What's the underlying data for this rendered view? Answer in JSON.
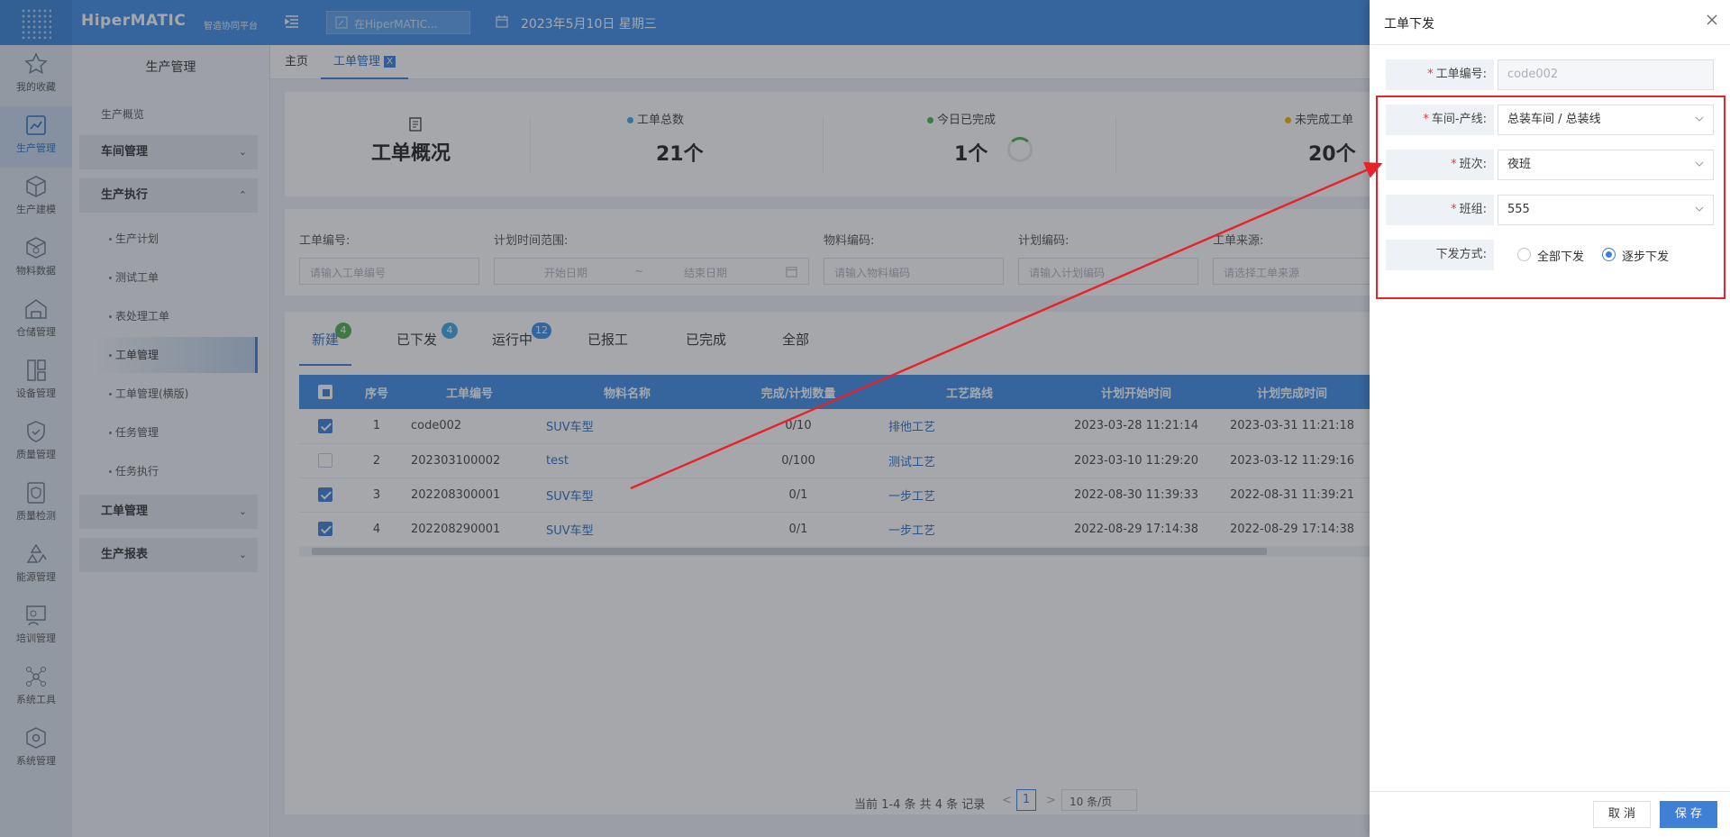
{
  "header": {
    "brand": "HiperMATIC",
    "brand_sub": "智造协同平台",
    "search_placeholder": "在HiperMATIC...",
    "date": "2023年5月10日 星期三"
  },
  "rail": [
    {
      "label": "我的收藏",
      "icon": "star-icon"
    },
    {
      "label": "生产管理",
      "icon": "production-icon"
    },
    {
      "label": "生产建模",
      "icon": "cube-icon"
    },
    {
      "label": "物料数据",
      "icon": "box-icon"
    },
    {
      "label": "仓储管理",
      "icon": "warehouse-icon"
    },
    {
      "label": "设备管理",
      "icon": "device-icon"
    },
    {
      "label": "质量管理",
      "icon": "shield-icon"
    },
    {
      "label": "质量检测",
      "icon": "shield-check-icon"
    },
    {
      "label": "能源管理",
      "icon": "recycle-icon"
    },
    {
      "label": "培训管理",
      "icon": "training-icon"
    },
    {
      "label": "系统工具",
      "icon": "network-icon"
    },
    {
      "label": "系统管理",
      "icon": "settings-cube-icon"
    }
  ],
  "sidebar": {
    "title": "生产管理",
    "overview": "生产概览",
    "groups": {
      "workshop": "车间管理",
      "execution": "生产执行",
      "workorder": "工单管理",
      "report": "生产报表"
    },
    "subitems": [
      "生产计划",
      "测试工单",
      "表处理工单",
      "工单管理",
      "工单管理(横版)",
      "任务管理",
      "任务执行"
    ]
  },
  "tabs": {
    "home": "主页",
    "current": "工单管理",
    "close": "X"
  },
  "overview": {
    "title": "工单概况",
    "stats": [
      {
        "label": "工单总数",
        "value": "21个",
        "color": "#3fa9e6"
      },
      {
        "label": "今日已完成",
        "value": "1个",
        "color": "#4caf50"
      },
      {
        "label": "未完成工单",
        "value": "20个",
        "color": "#f0b400"
      }
    ]
  },
  "filters": [
    {
      "label": "工单编号:",
      "placeholder": "请输入工单编号"
    },
    {
      "label": "计划时间范围:",
      "start": "开始日期",
      "sep": "~",
      "end": "结束日期"
    },
    {
      "label": "物料编码:",
      "placeholder": "请输入物料编码"
    },
    {
      "label": "计划编码:",
      "placeholder": "请输入计划编码"
    },
    {
      "label": "工单来源:",
      "placeholder": "请选择工单来源"
    }
  ],
  "status_tabs": [
    {
      "label": "新建",
      "badge": "4",
      "badge_color": "#4caf50"
    },
    {
      "label": "已下发",
      "badge": "4",
      "badge_color": "#3fa9e6"
    },
    {
      "label": "运行中",
      "badge": "12",
      "badge_color": "#3f8ee6"
    },
    {
      "label": "已报工",
      "badge": ""
    },
    {
      "label": "已完成",
      "badge": ""
    },
    {
      "label": "全部",
      "badge": ""
    }
  ],
  "table": {
    "headers": [
      "序号",
      "工单编号",
      "物料名称",
      "完成/计划数量",
      "工艺路线",
      "计划开始时间",
      "计划完成时间"
    ],
    "rows": [
      {
        "checked": true,
        "no": "1",
        "code": "code002",
        "material": "SUV车型",
        "qty": "0/10",
        "route": "排他工艺",
        "start": "2023-03-28 11:21:14",
        "end": "2023-03-31 11:21:18"
      },
      {
        "checked": false,
        "no": "2",
        "code": "202303100002",
        "material": "test",
        "qty": "0/100",
        "route": "测试工艺",
        "start": "2023-03-10 11:29:20",
        "end": "2023-03-12 11:29:16"
      },
      {
        "checked": true,
        "no": "3",
        "code": "202208300001",
        "material": "SUV车型",
        "qty": "0/1",
        "route": "一步工艺",
        "start": "2022-08-30 11:39:33",
        "end": "2022-08-31 11:39:21"
      },
      {
        "checked": true,
        "no": "4",
        "code": "202208290001",
        "material": "SUV车型",
        "qty": "0/1",
        "route": "一步工艺",
        "start": "2022-08-29 17:14:38",
        "end": "2022-08-29 17:14:38"
      }
    ]
  },
  "pager": {
    "summary": "当前 1-4 条 共 4 条 记录",
    "page": "1",
    "prev": "<",
    "next": ">",
    "size": "10 条/页"
  },
  "drawer": {
    "title": "工单下发",
    "fields": {
      "code_label": "工单编号:",
      "code_value": "code002",
      "line_label": "车间-产线:",
      "line_value": "总装车间 / 总装线",
      "shift_label": "班次:",
      "shift_value": "夜班",
      "team_label": "班组:",
      "team_value": "555",
      "mode_label": "下发方式:",
      "mode_all": "全部下发",
      "mode_step": "逐步下发",
      "mode_selected": "逐步下发"
    },
    "cancel": "取 消",
    "save": "保 存"
  },
  "colors": {
    "primary": "#3f8ee6",
    "annotation_red": "#e8212b"
  }
}
